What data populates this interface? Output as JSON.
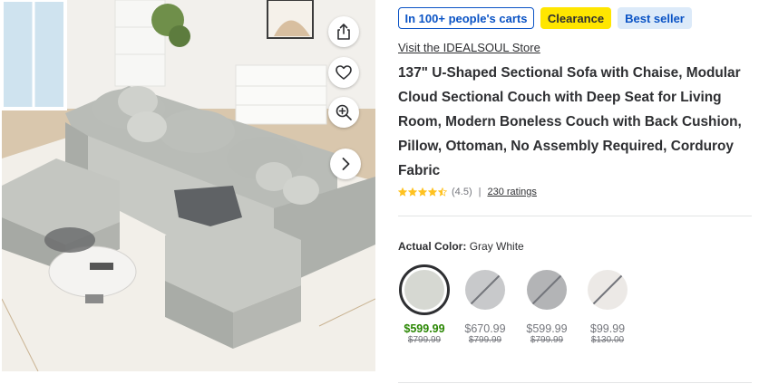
{
  "badges": [
    {
      "label": "In 100+ people's carts"
    },
    {
      "label": "Clearance"
    },
    {
      "label": "Best seller"
    }
  ],
  "store_link": "Visit the IDEALSOUL Store",
  "title": "137\" U-Shaped Sectional Sofa with Chaise, Modular Cloud Sectional Couch with Deep Seat for Living Room, Modern Boneless Couch with Back Cushion, Pillow, Ottoman, No Assembly Required, Corduroy Fabric",
  "rating": {
    "value": "(4.5)",
    "stars": 4.5,
    "separator": "|",
    "count_label": "230 ratings"
  },
  "color": {
    "label": "Actual Color:",
    "selected": "Gray White"
  },
  "swatches": [
    {
      "price": "$599.99",
      "was": "$799.99",
      "fill": "#d6d8d2",
      "selected": true,
      "available": true
    },
    {
      "price": "$670.99",
      "was": "$799.99",
      "fill": "#c8c9cb",
      "selected": false,
      "available": false
    },
    {
      "price": "$599.99",
      "was": "$799.99",
      "fill": "#b3b4b6",
      "selected": false,
      "available": false
    },
    {
      "price": "$99.99",
      "was": "$130.00",
      "fill": "#ece9e6",
      "selected": false,
      "available": false
    }
  ],
  "icons": {
    "share": "share-icon",
    "favorite": "heart-icon",
    "zoom": "zoom-in-icon",
    "next": "chevron-right-icon"
  },
  "colors": {
    "brand_blue": "#0a53c5",
    "clearance_yellow": "#ffe600",
    "price_green": "#2a8703",
    "star_gold": "#ffc220"
  }
}
